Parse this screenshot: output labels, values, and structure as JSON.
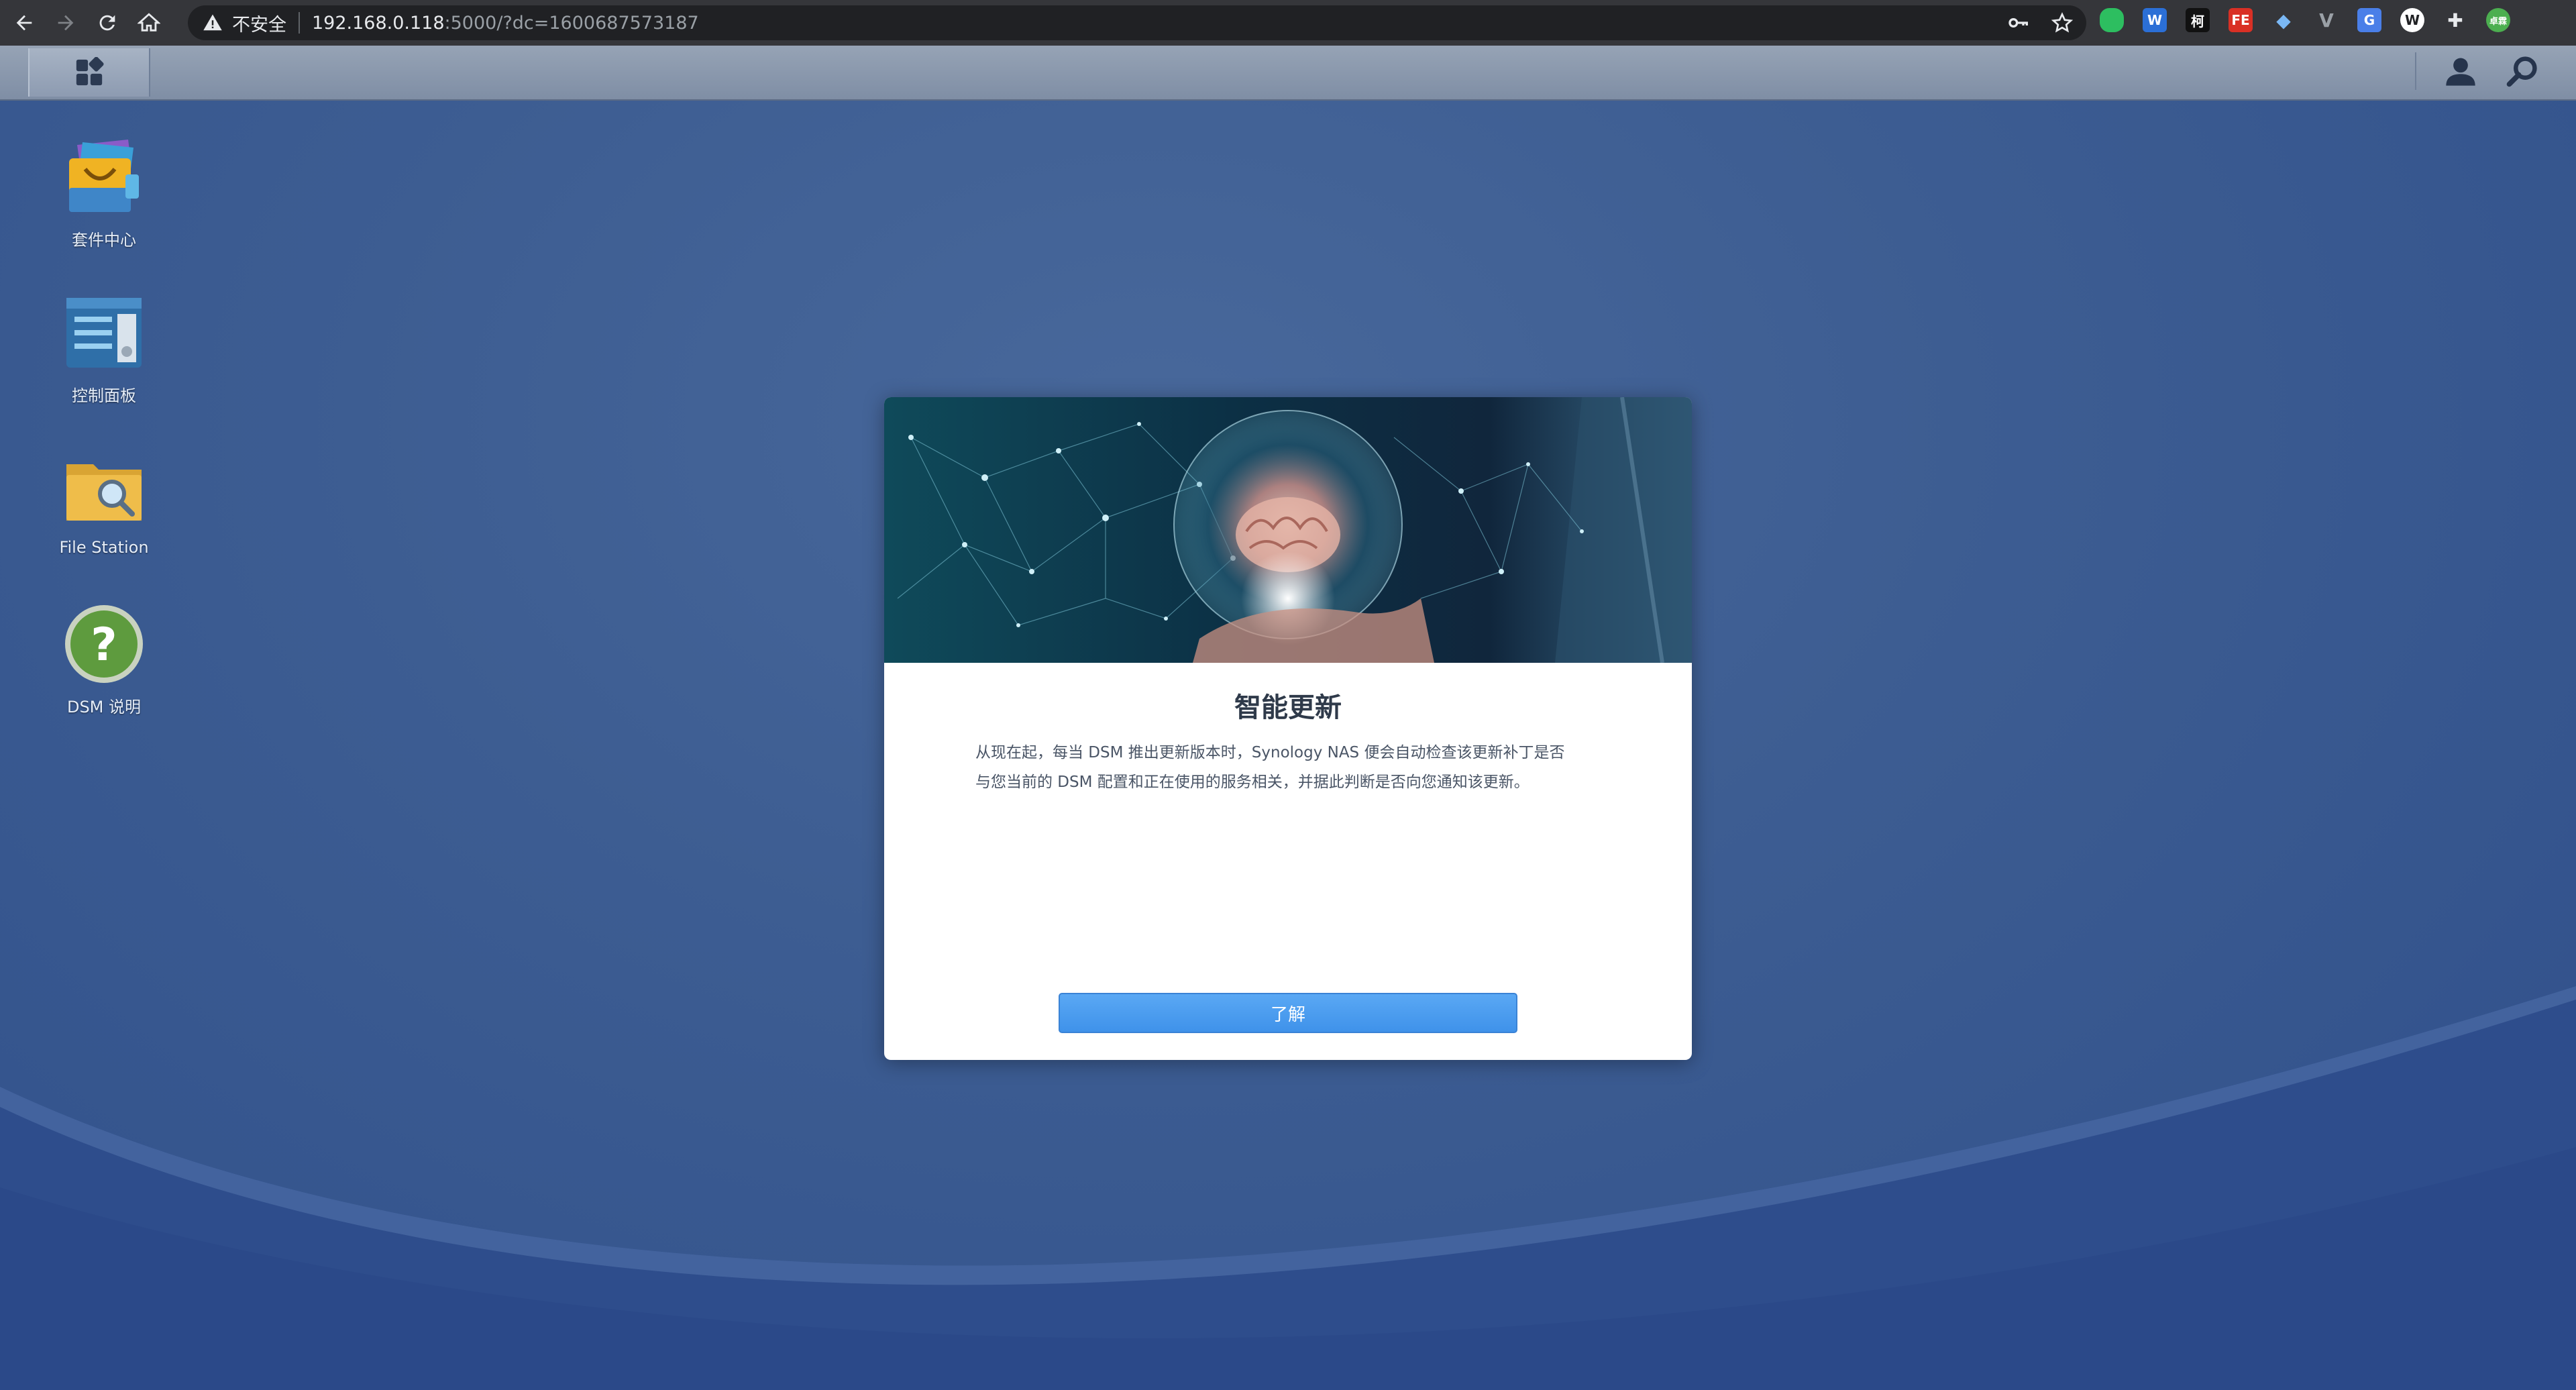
{
  "browser": {
    "security_label": "不安全",
    "url_host": "192.168.0.118",
    "url_rest": ":5000/?dc=1600687573187",
    "nav": [
      "back-icon",
      "forward-icon",
      "reload-icon",
      "home-icon"
    ],
    "omnibox_icons": [
      "key-icon",
      "star-icon"
    ],
    "extensions": [
      {
        "name": "evernote-extension-icon",
        "glyph": "",
        "color": "#2dbe60"
      },
      {
        "name": "w-extension-icon",
        "glyph": "W",
        "color": "#2b6fd6"
      },
      {
        "name": "he-extension-icon",
        "glyph": "柯",
        "color": "#111111"
      },
      {
        "name": "fe-extension-icon",
        "glyph": "FE",
        "color": "#d93025"
      },
      {
        "name": "diamond-extension-icon",
        "glyph": "",
        "color": "#7ab8f5"
      },
      {
        "name": "v-extension-icon",
        "glyph": "V",
        "color": "#9aa0a6"
      },
      {
        "name": "translate-extension-icon",
        "glyph": "G",
        "color": "#4a7fe8"
      },
      {
        "name": "w-circle-extension-icon",
        "glyph": "W",
        "color": "#ffffff"
      },
      {
        "name": "puzzle-extension-icon",
        "glyph": "",
        "color": "#e8eaed"
      },
      {
        "name": "profile-avatar-icon",
        "glyph": "卓霖",
        "color": "#4caf50"
      }
    ]
  },
  "taskbar": {
    "main_menu": "main-menu-icon",
    "right_icons": [
      "user-icon",
      "search-icon"
    ]
  },
  "desktop": {
    "icons": [
      {
        "label": "套件中心",
        "icon": "package-center-icon"
      },
      {
        "label": "控制面板",
        "icon": "control-panel-icon"
      },
      {
        "label": "File Station",
        "icon": "file-station-icon"
      },
      {
        "label": "DSM 说明",
        "icon": "dsm-help-icon"
      }
    ]
  },
  "dialog": {
    "title": "智能更新",
    "body_line1": "从现在起，每当 DSM 推出更新版本时，Synology NAS 便会自动检查该更新补丁是否",
    "body_line2": "与您当前的 DSM 配置和正在使用的服务相关，并据此判断是否向您通知该更新。",
    "button_label": "了解"
  }
}
